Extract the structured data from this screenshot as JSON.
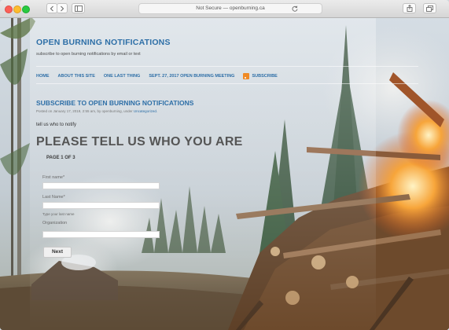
{
  "browser": {
    "address": "Not Secure — openburning.ca",
    "icons": [
      "back-icon",
      "forward-icon",
      "sidebar-icon",
      "reload-icon",
      "share-icon",
      "tabs-icon"
    ]
  },
  "site": {
    "title": "OPEN BURNING NOTIFICATIONS",
    "description": "subscribe to open burning notifications by email or text"
  },
  "nav": {
    "items": [
      "HOME",
      "ABOUT THIS SITE",
      "ONE LAST THING",
      "SEPT. 27, 2017 OPEN BURNING MEETING",
      "SUBSCRIBE"
    ],
    "rss_color": "#f08a24"
  },
  "post": {
    "title": "SUBSCRIBE TO OPEN BURNING NOTIFICATIONS",
    "meta_prefix": "Posted on January 17, 2019, 2:55 am, by openburning, under",
    "meta_category": "Uncategorized."
  },
  "form": {
    "intro": "tell us who to notify",
    "heading": "PLEASE TELL US WHO YOU ARE",
    "page_indicator": "PAGE 1 OF 3",
    "fields": [
      {
        "label": "First name*",
        "value": ""
      },
      {
        "label": "Last Name*",
        "value": "",
        "hint": "Type your last name"
      },
      {
        "label": "Organization",
        "value": ""
      }
    ],
    "next_label": "Next"
  },
  "colors": {
    "accent": "#2e6fa7",
    "heading": "#555555"
  }
}
